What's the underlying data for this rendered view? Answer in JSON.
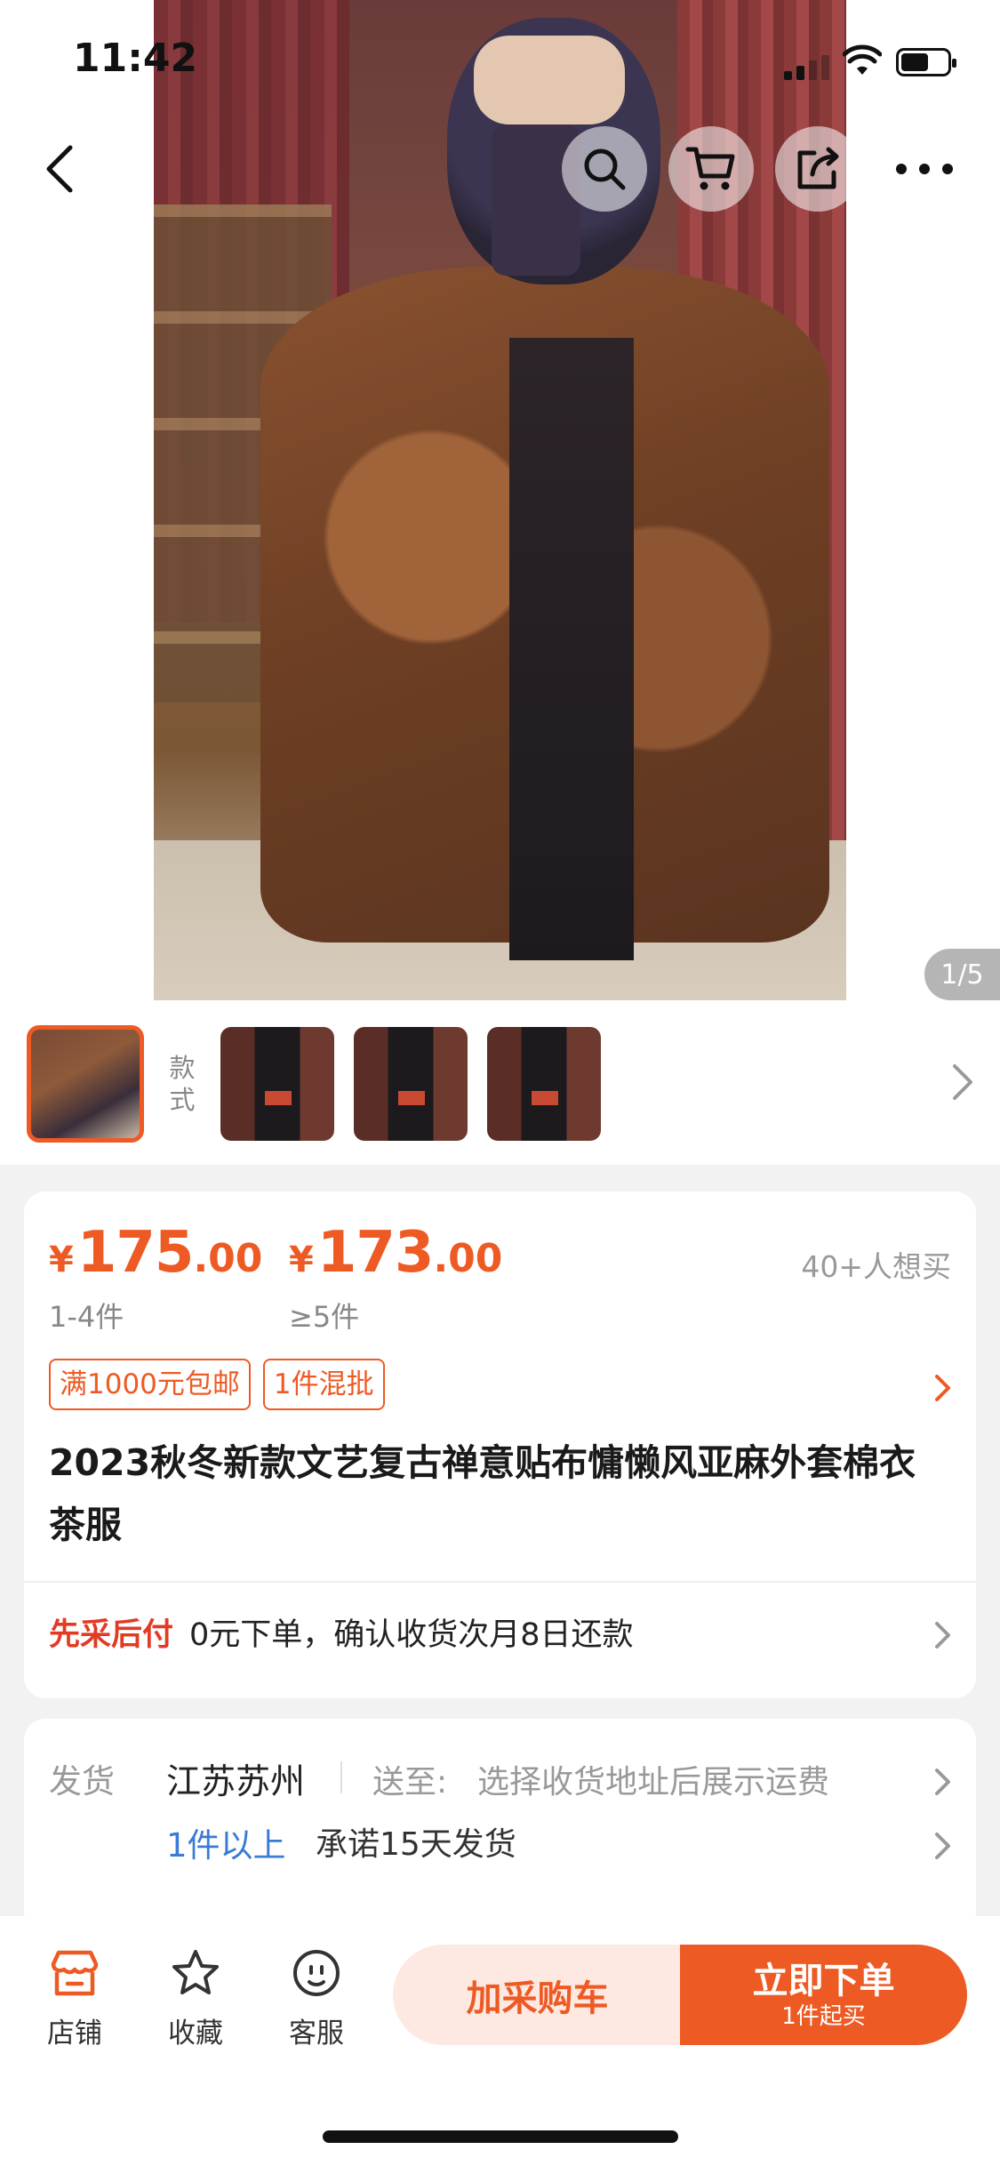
{
  "status_bar": {
    "time": "11:42"
  },
  "gallery": {
    "pager": "1/5",
    "style_label": "款式"
  },
  "pricing": {
    "tiers": [
      {
        "currency": "¥",
        "integer": "175",
        "decimal": ".00",
        "qty": "1-4件"
      },
      {
        "currency": "¥",
        "integer": "173",
        "decimal": ".00",
        "qty": "≥5件"
      }
    ],
    "want_count": "40+人想买",
    "tags": [
      "满1000元包邮",
      "1件混批"
    ]
  },
  "product": {
    "title": "2023秋冬新款文艺复古禅意贴布慵懒风亚麻外套棉衣茶服"
  },
  "payment": {
    "tag": "先采后付",
    "text": "0元下单，确认收货次月8日还款"
  },
  "shipping": {
    "label": "发货",
    "origin": "江苏苏州",
    "to_label": "送至:",
    "to_value": "选择收货地址后展示运费",
    "min_qty": "1件以上",
    "promise": "承诺15天发货"
  },
  "bottom_bar": {
    "store": "店铺",
    "favorite": "收藏",
    "service": "客服",
    "add_cart": "加采购车",
    "buy_now": "立即下单",
    "buy_sub": "1件起买"
  },
  "colors": {
    "accent": "#ee5a24",
    "link_blue": "#3a7bd5",
    "pay_red": "#e23b24"
  }
}
